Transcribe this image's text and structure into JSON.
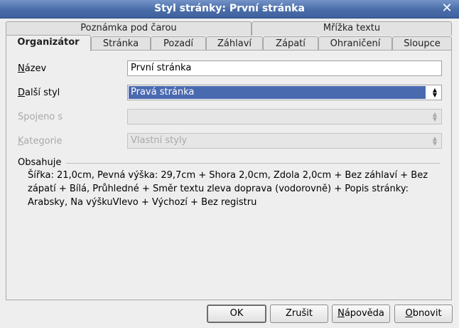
{
  "window": {
    "title": "Styl stránky: První stránka"
  },
  "tabs_back": [
    {
      "label": "Poznámka pod čarou"
    },
    {
      "label": "Mřížka textu"
    }
  ],
  "tabs_front": [
    {
      "label": "Organizátor",
      "active": true
    },
    {
      "label": "Stránka"
    },
    {
      "label": "Pozadí"
    },
    {
      "label": "Záhlaví"
    },
    {
      "label": "Zápatí"
    },
    {
      "label": "Ohraničení"
    },
    {
      "label": "Sloupce"
    }
  ],
  "form": {
    "name_label_mn": "N",
    "name_label_rest": "ázev",
    "name_value": "První stránka",
    "next_label_mn": "D",
    "next_label_rest": "alší styl",
    "next_value": "Pravá stránka",
    "linked_label": "Spojeno s",
    "linked_value": "",
    "category_label_mn": "K",
    "category_label_rest": "ategorie",
    "category_value": "Vlastní styly"
  },
  "contains": {
    "heading": "Obsahuje",
    "text": "Šířka: 21,0cm, Pevná výška: 29,7cm + Shora 2,0cm, Zdola 2,0cm + Bez záhlaví + Bez zápatí + Bílá, Průhledné + Směr textu zleva doprava (vodorovně) + Popis stránky: Arabsky, Na výškuVlevo + Výchozí + Bez registru"
  },
  "buttons": {
    "ok": "OK",
    "cancel": "Zrušit",
    "help_mn": "N",
    "help_rest": "ápověda",
    "reset_mn": "O",
    "reset_rest": "bnovit"
  }
}
